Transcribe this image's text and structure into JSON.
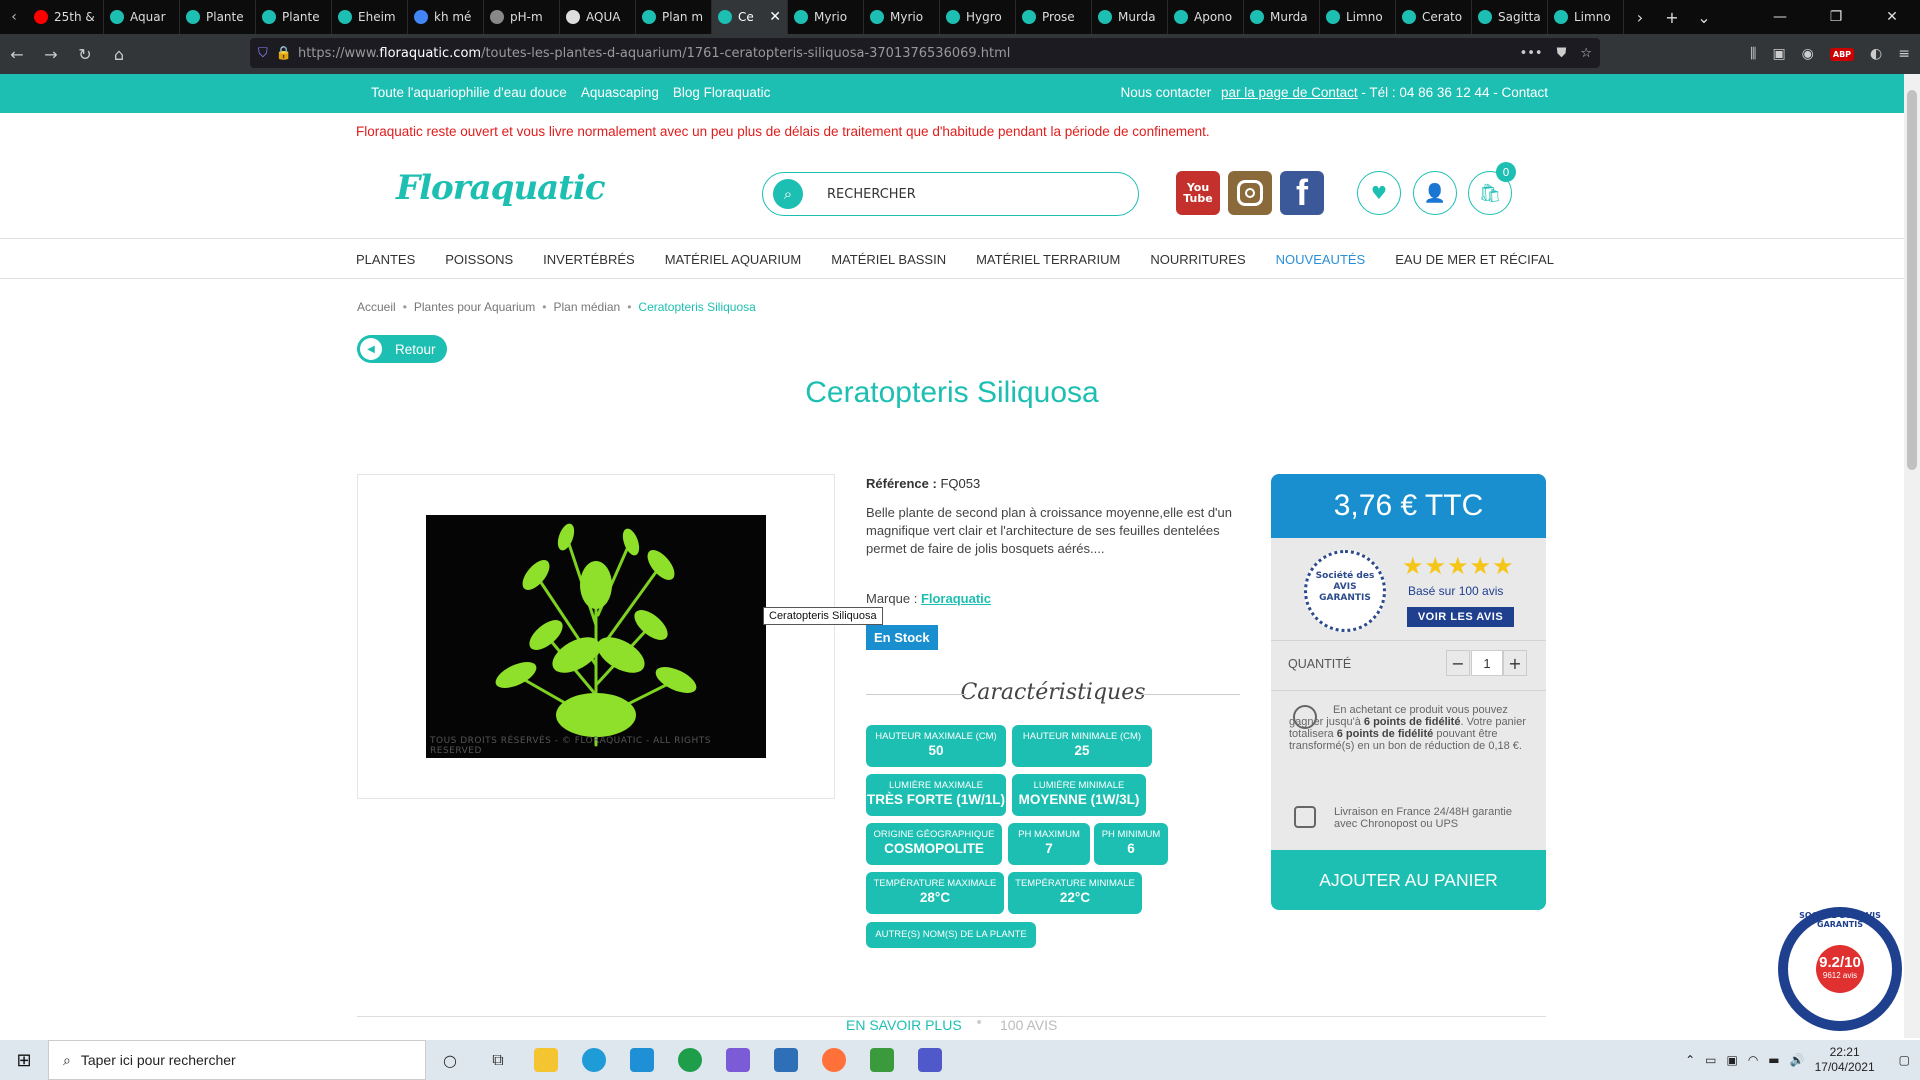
{
  "browser": {
    "tabs": [
      {
        "label": "25th &",
        "color": "#ff0000"
      },
      {
        "label": "Aquar",
        "color": "#1dbfb2"
      },
      {
        "label": "Plante",
        "color": "#1dbfb2"
      },
      {
        "label": "Plante",
        "color": "#1dbfb2"
      },
      {
        "label": "Eheim",
        "color": "#1dbfb2"
      },
      {
        "label": "kh mé",
        "color": "#4285f4"
      },
      {
        "label": "pH-m",
        "color": "#888888"
      },
      {
        "label": "AQUA",
        "color": "#dddddd"
      },
      {
        "label": "Plan m",
        "color": "#1dbfb2"
      },
      {
        "label": "Ce",
        "color": "#1dbfb2",
        "active": true
      },
      {
        "label": "Myrio",
        "color": "#1dbfb2"
      },
      {
        "label": "Myrio",
        "color": "#1dbfb2"
      },
      {
        "label": "Hygro",
        "color": "#1dbfb2"
      },
      {
        "label": "Prose",
        "color": "#1dbfb2"
      },
      {
        "label": "Murda",
        "color": "#1dbfb2"
      },
      {
        "label": "Apono",
        "color": "#1dbfb2"
      },
      {
        "label": "Murda",
        "color": "#1dbfb2"
      },
      {
        "label": "Limno",
        "color": "#1dbfb2"
      },
      {
        "label": "Cerato",
        "color": "#1dbfb2"
      },
      {
        "label": "Sagitta",
        "color": "#1dbfb2"
      },
      {
        "label": "Limno",
        "color": "#1dbfb2"
      }
    ],
    "url_prefix": "https://www.",
    "url_domain": "floraquatic.com",
    "url_path": "/toutes-les-plantes-d-aquarium/1761-ceratopteris-siliquosa-3701376536069.html"
  },
  "topbar": {
    "links": [
      "Toute l'aquariophilie d'eau douce",
      "Aquascaping",
      "Blog Floraquatic"
    ],
    "contact_prefix": "Nous contacter",
    "contact_link": "par la page de Contact",
    "contact_suffix": " - Tél : 04 86 36 12 44 - Contact"
  },
  "notice": "Floraquatic reste ouvert et vous livre normalement avec un peu plus de délais de traitement que d'habitude pendant la période de confinement.",
  "header": {
    "logo": "Floraquatic",
    "search_label": "RECHERCHER",
    "cart_count": "0",
    "youtube_top": "You",
    "youtube_bottom": "Tube",
    "facebook": "f"
  },
  "nav": [
    "PLANTES",
    "POISSONS",
    "INVERTÉBRÉS",
    "MATÉRIEL AQUARIUM",
    "MATÉRIEL BASSIN",
    "MATÉRIEL TERRARIUM",
    "NOURRITURES",
    "NOUVEAUTÉS",
    "EAU DE MER ET RÉCIFAL"
  ],
  "breadcrumb": [
    "Accueil",
    "Plantes pour Aquarium",
    "Plan médian",
    "Ceratopteris Siliquosa"
  ],
  "back_label": "Retour",
  "product": {
    "title": "Ceratopteris Siliquosa",
    "image_tooltip": "Ceratopteris Siliquosa",
    "watermark": "TOUS DROITS RÉSERVÉS - © FLORAQUATIC - ALL RIGHTS RESERVED",
    "ref_label": "Référence :",
    "ref_value": "FQ053",
    "description": "Belle plante de second plan à croissance moyenne,elle est d'un magnifique vert clair et l'architecture de ses feuilles dentelées permet de faire de jolis bosquets aérés....",
    "brand_label": "Marque :",
    "brand_value": "Floraquatic",
    "stock": "En Stock",
    "characteristics_title": "Caractéristiques",
    "characteristics": [
      {
        "label": "Hauteur maximale (cm)",
        "value": "50"
      },
      {
        "label": "Hauteur minimale (cm)",
        "value": "25"
      },
      {
        "label": "Lumière maximale",
        "value": "Très forte (1W/1L)"
      },
      {
        "label": "Lumière minimale",
        "value": "Moyenne (1W/3L)"
      },
      {
        "label": "Origine géographique",
        "value": "Cosmopolite"
      },
      {
        "label": "pH maximum",
        "value": "7"
      },
      {
        "label": "pH minimum",
        "value": "6"
      },
      {
        "label": "Température maximale",
        "value": "28°C"
      },
      {
        "label": "Température minimale",
        "value": "22°C"
      },
      {
        "label": "Autre(s) nom(s) de la plante",
        "value": ""
      }
    ]
  },
  "panel": {
    "price": "3,76 € TTC",
    "avis_logo": "Société des AVIS GARANTIS",
    "rating_stars": 5,
    "based_on": "Basé sur 100 avis",
    "voir_avis": "VOIR LES AVIS",
    "quantity_label": "QUANTITÉ",
    "quantity_value": "1",
    "loyalty_pre": "En achetant ce produit vous pouvez gagner jusqu'à ",
    "loyalty_points1": "6 points de fidélité",
    "loyalty_mid": ". Votre panier totalisera ",
    "loyalty_points2": "6 points de fidélité",
    "loyalty_post": " pouvant être transformé(s) en un bon de réduction de 0,18 €.",
    "shipping": "Livraison en France 24/48H garantie avec Chronopost ou UPS",
    "add_to_cart": "AJOUTER AU PANIER"
  },
  "bottom_tabs": [
    "EN SAVOIR PLUS",
    "100 AVIS"
  ],
  "seal": {
    "score": "9.2/10",
    "count": "9612 avis",
    "ring": "SOCIÉTÉ DES AVIS GARANTIS"
  },
  "taskbar": {
    "search_placeholder": "Taper ici pour rechercher",
    "time": "22:21",
    "date": "17/04/2021"
  },
  "colors": {
    "brand": "#1dbfb2",
    "price": "#1a8fcf",
    "notice": "#e01c1c",
    "avis_blue": "#1f3f8f"
  }
}
